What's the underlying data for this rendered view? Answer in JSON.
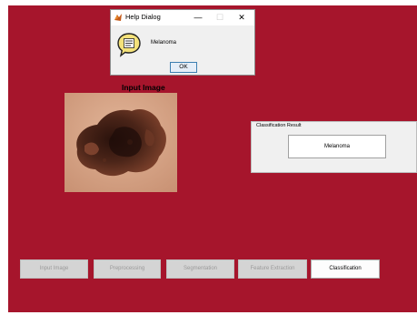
{
  "colors": {
    "figure_background": "#a6152c",
    "panel": "#f0f0f0"
  },
  "dialog": {
    "title": "Help Dialog",
    "minimize": "—",
    "maximize": "☐",
    "close": "✕",
    "icon": "help-speech-bubble-icon",
    "message": "Melanoma",
    "ok_label": "OK"
  },
  "input_panel": {
    "title": "Input Image"
  },
  "result": {
    "label": "Classification Result",
    "value": "Melanoma"
  },
  "buttons": [
    {
      "label": "Input Image",
      "enabled": false
    },
    {
      "label": "Preprocessing",
      "enabled": false
    },
    {
      "label": "Segmentation",
      "enabled": false
    },
    {
      "label": "Feature Extraction",
      "enabled": false
    },
    {
      "label": "Classification",
      "enabled": true
    }
  ]
}
